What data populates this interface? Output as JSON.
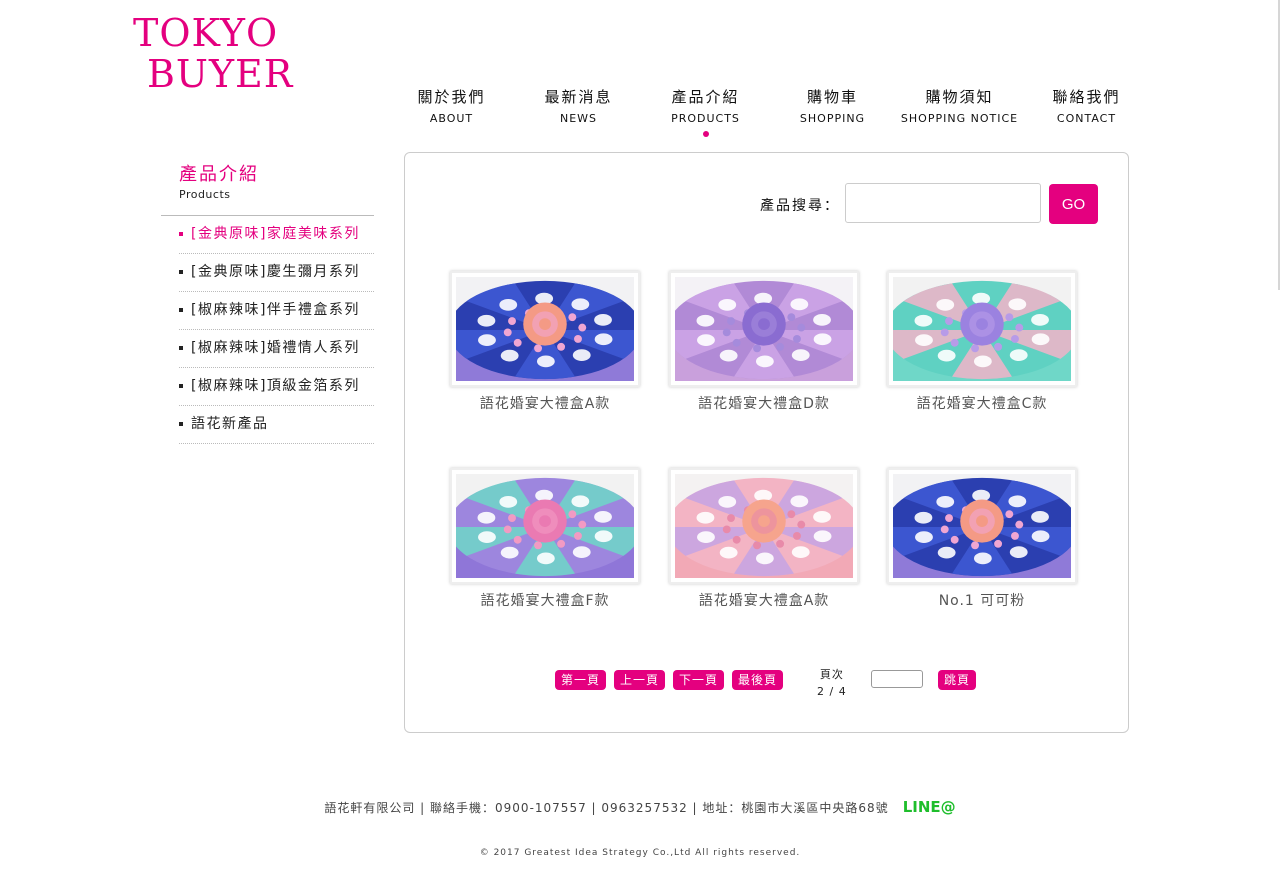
{
  "brand": {
    "line1": "TOKYO",
    "line2": "BUYER"
  },
  "nav": [
    {
      "zh": "關於我們",
      "en": "ABOUT"
    },
    {
      "zh": "最新消息",
      "en": "NEWS"
    },
    {
      "zh": "產品介紹",
      "en": "PRODUCTS",
      "active": true
    },
    {
      "zh": "購物車",
      "en": "SHOPPING"
    },
    {
      "zh": "購物須知",
      "en": "SHOPPING NOTICE"
    },
    {
      "zh": "聯絡我們",
      "en": "CONTACT"
    }
  ],
  "sidebar": {
    "title": "產品介紹",
    "subtitle": "Products",
    "items": [
      {
        "label": "[金典原味]家庭美味系列",
        "active": true
      },
      {
        "label": "[金典原味]慶生彌月系列"
      },
      {
        "label": "[椒麻辣味]伴手禮盒系列"
      },
      {
        "label": "[椒麻辣味]婚禮情人系列"
      },
      {
        "label": "[椒麻辣味]頂級金箔系列"
      },
      {
        "label": "語花新產品"
      }
    ]
  },
  "search": {
    "label": "產品搜尋：",
    "value": "",
    "button": "GO"
  },
  "products": [
    {
      "name": "語花婚宴大禮盒A款",
      "palette": "blue-peach"
    },
    {
      "name": "語花婚宴大禮盒D款",
      "palette": "purple"
    },
    {
      "name": "語花婚宴大禮盒C款",
      "palette": "mint-pink"
    },
    {
      "name": "語花婚宴大禮盒F款",
      "palette": "mint-purple"
    },
    {
      "name": "語花婚宴大禮盒A款",
      "palette": "pink-purple"
    },
    {
      "name": "No.1 可可粉",
      "palette": "blue-peach"
    }
  ],
  "pager": {
    "first": "第一頁",
    "prev": "上一頁",
    "next": "下一頁",
    "last": "最後頁",
    "label": "頁次",
    "current": "2 / 4",
    "jump_value": "",
    "jump": "跳頁"
  },
  "footer": {
    "info": "語花軒有限公司 | 聯絡手機：0900-107557 | 0963257532 | 地址：桃園市大溪區中央路68號",
    "line": "LINE@",
    "copyright": "© 2017 Greatest Idea Strategy Co.,Ltd All rights reserved."
  },
  "colors": {
    "accent": "#e4007f",
    "line_green": "#1fbe2c"
  }
}
